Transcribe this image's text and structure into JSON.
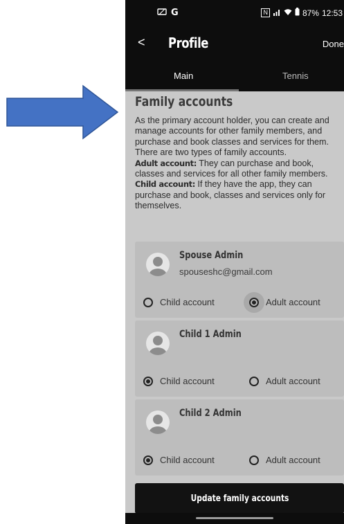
{
  "status_bar": {
    "left_icons": [
      "notification-icon",
      "google-icon"
    ],
    "g_label": "G",
    "nfc": "N",
    "battery": "87%",
    "time": "12:53"
  },
  "header": {
    "back_label": "<",
    "title": "Profile",
    "done_label": "Done"
  },
  "tabs": [
    {
      "label": "Main",
      "active": true
    },
    {
      "label": "Tennis",
      "active": false
    }
  ],
  "family": {
    "title": "Family accounts",
    "intro": "As the primary account holder, you can create and manage accounts for other family members, and purchase and book classes and services for them. There are two types of family accounts.",
    "adult_label": "Adult account:",
    "adult_text": " They can purchase and book, classes and services for all other family members.",
    "child_label": "Child account:",
    "child_text": " If they have the app, they can purchase and book, classes and services only for themselves."
  },
  "accounts": [
    {
      "name": "Spouse Admin",
      "email": "spouseshc@gmail.com",
      "child_option": "Child account",
      "adult_option": "Adult account",
      "selected": "adult"
    },
    {
      "name": "Child 1 Admin",
      "email": "",
      "child_option": "Child account",
      "adult_option": "Adult account",
      "selected": "child"
    },
    {
      "name": "Child 2 Admin",
      "email": "",
      "child_option": "Child account",
      "adult_option": "Adult account",
      "selected": "child"
    }
  ],
  "update_button": "Update family accounts",
  "colors": {
    "arrow": "#4472c4",
    "dark": "#0d0d0d",
    "card": "#bdbdbd",
    "background": "#c9c9c9"
  }
}
